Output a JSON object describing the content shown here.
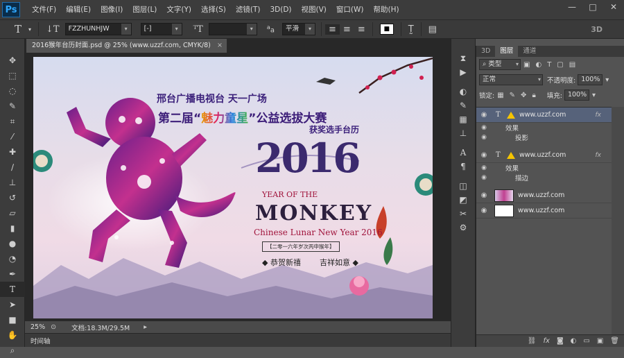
{
  "app": {
    "logo": "Ps"
  },
  "menu": [
    "文件(F)",
    "编辑(E)",
    "图像(I)",
    "图层(L)",
    "文字(Y)",
    "选择(S)",
    "滤镜(T)",
    "3D(D)",
    "视图(V)",
    "窗口(W)",
    "帮助(H)"
  ],
  "window_controls": {
    "minimize": "—",
    "maximize": "□",
    "close": "✕"
  },
  "options": {
    "font_family": "FZZHUNHJW",
    "font_style": "[-]",
    "font_size": "",
    "antialias_label": "a",
    "antialias_value": "平滑",
    "color_swatch_label": "■",
    "mode_3d": "3D"
  },
  "document": {
    "tab_title": "2016猴年台历封面.psd @ 25% (www.uzzf.com, CMYK/8)",
    "zoom": "25%",
    "doc_info": "文档:18.3M/29.5M",
    "timeline_label": "时间轴"
  },
  "poster": {
    "line1": "邢台广播电视台  天一广场",
    "line2_pre": "第二届“",
    "line2_hl": "魅力童星",
    "line2_post": "”公益选拔大赛",
    "line3": "获奖选手台历",
    "year": "2016",
    "year_of": "YEAR OF THE",
    "monkey": "MONKEY",
    "cny": "Chinese Lunar New Year 2016",
    "box": "【二零一六年岁次丙申猴年】",
    "greet1": "◆ 恭贺新禧",
    "greet2": "吉祥如意 ◆"
  },
  "layers_panel": {
    "tabs": [
      "3D",
      "图层",
      "通道"
    ],
    "active_tab": "图层",
    "filter_kind": "类型",
    "blend_mode": "正常",
    "opacity_label": "不透明度:",
    "opacity_value": "100%",
    "lock_label": "锁定:",
    "fill_label": "填充:",
    "fill_value": "100%",
    "layers": [
      {
        "name": "www.uzzf.com",
        "type": "text",
        "selected": true,
        "fx": "fx",
        "effects_label": "效果",
        "effects": [
          "投影"
        ]
      },
      {
        "name": "www.uzzf.com",
        "type": "text",
        "selected": false,
        "fx": "fx",
        "effects_label": "效果",
        "effects": [
          "描边"
        ]
      },
      {
        "name": "www.uzzf.com",
        "type": "image",
        "selected": false
      },
      {
        "name": "www.uzzf.com",
        "type": "white",
        "selected": false
      }
    ]
  }
}
